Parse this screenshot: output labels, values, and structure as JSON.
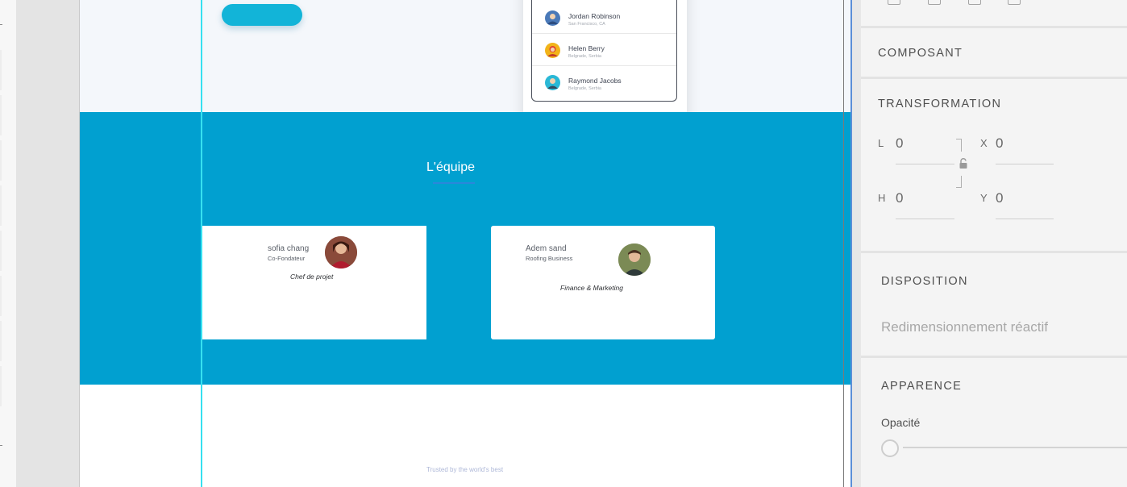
{
  "canvas": {
    "hero": {
      "contacts": [
        {
          "name": "Jordan Robinson",
          "location": "San Francisco, CA",
          "avatar_color": "#4a79b8",
          "avatar_icon": "person-icon"
        },
        {
          "name": "Helen Berry",
          "location": "Belgrade, Serbia",
          "avatar_color": "#f2b419",
          "avatar_icon": "person-icon"
        },
        {
          "name": "Raymond Jacobs",
          "location": "Belgrade, Serbia",
          "avatar_color": "#2ab8d6",
          "avatar_icon": "person-icon"
        }
      ]
    },
    "team": {
      "title": "L'équipe",
      "members": [
        {
          "name": "sofia chang",
          "role": "Co-Fondateur",
          "job": "Chef de projet"
        },
        {
          "name": "Adem sand",
          "role": "Roofing Business",
          "job": "Finance & Marketing"
        }
      ]
    },
    "footer": {
      "trusted": "Trusted by the world's best"
    },
    "colors": {
      "band": "#01a0d0",
      "cta": "#12b4d8",
      "guide": "#36e0f0"
    }
  },
  "panel": {
    "component_heading": "COMPOSANT",
    "transform_heading": "TRANSFORMATION",
    "fields": {
      "w_label": "L",
      "w_value": "0",
      "x_label": "X",
      "x_value": "0",
      "h_label": "H",
      "h_value": "0",
      "y_label": "Y",
      "y_value": "0"
    },
    "layout_heading": "DISPOSITION",
    "responsive_label": "Redimensionnement réactif",
    "appearance_heading": "APPARENCE",
    "opacity_label": "Opacité",
    "opacity_value": 0
  }
}
